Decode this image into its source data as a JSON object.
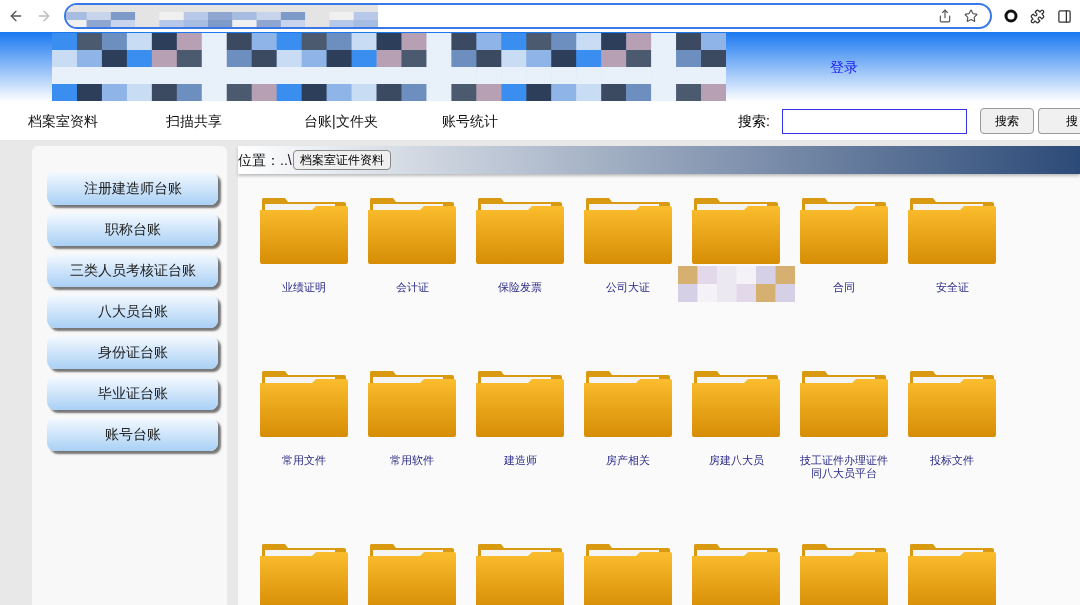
{
  "header": {
    "login_link": "登录"
  },
  "nav": {
    "items": [
      {
        "label": "档案室资料"
      },
      {
        "label": "扫描共享"
      },
      {
        "label": "台账|文件夹"
      },
      {
        "label": "账号统计"
      }
    ],
    "search_label": "搜索:",
    "search_buttons": [
      "搜索",
      "搜"
    ]
  },
  "sidebar": {
    "items": [
      "注册建造师台账",
      "职称台账",
      "三类人员考核证台账",
      "八大员台账",
      "身份证台账",
      "毕业证台账",
      "账号台账"
    ]
  },
  "breadcrumb": {
    "label": "位置：..\\",
    "current": "档案室证件资料"
  },
  "folders": [
    {
      "kind": "folder",
      "label": "业绩证明"
    },
    {
      "kind": "folder",
      "label": "会计证"
    },
    {
      "kind": "folder",
      "label": "保险发票"
    },
    {
      "kind": "folder",
      "label": "公司大证"
    },
    {
      "kind": "redacted"
    },
    {
      "kind": "folder",
      "label": "合同"
    },
    {
      "kind": "folder",
      "label": "安全证"
    },
    {
      "kind": "folder",
      "label": "常用文件"
    },
    {
      "kind": "folder",
      "label": "常用软件"
    },
    {
      "kind": "folder",
      "label": "建造师"
    },
    {
      "kind": "folder",
      "label": "房产相关"
    },
    {
      "kind": "folder",
      "label": "房建八大员"
    },
    {
      "kind": "folder",
      "label": "技工证件办理证件同八大员平台"
    },
    {
      "kind": "folder",
      "label": "投标文件"
    },
    {
      "kind": "folder"
    },
    {
      "kind": "folder"
    },
    {
      "kind": "folder"
    },
    {
      "kind": "folder"
    },
    {
      "kind": "folder"
    },
    {
      "kind": "folder"
    },
    {
      "kind": "folder"
    }
  ]
}
